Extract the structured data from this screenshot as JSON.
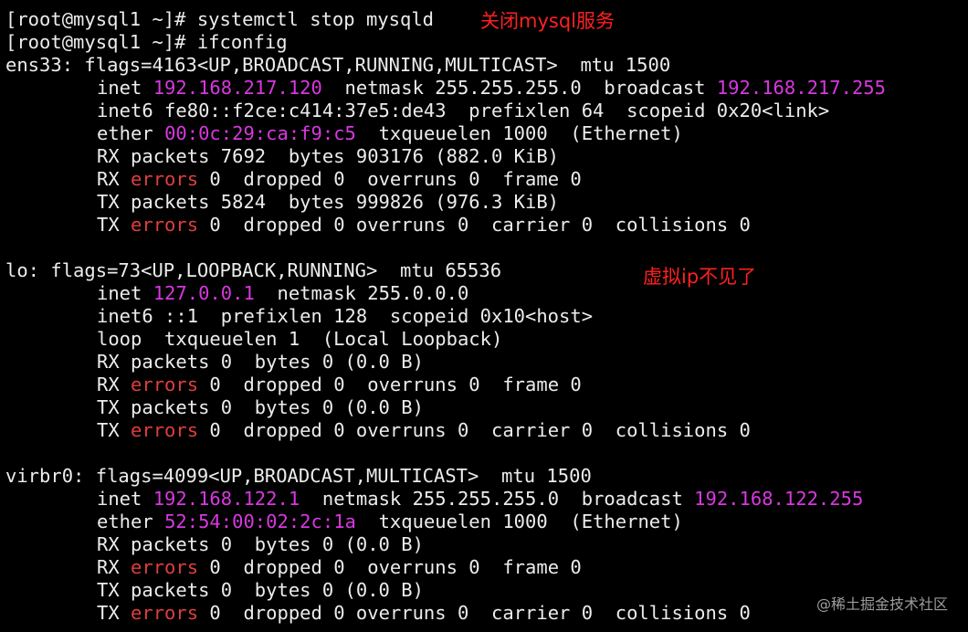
{
  "terminal": {
    "lines": [
      {
        "parts": [
          {
            "t": "[root@mysql1 ~]# systemctl stop mysqld"
          }
        ]
      },
      {
        "parts": [
          {
            "t": "[root@mysql1 ~]# ifconfig"
          }
        ]
      },
      {
        "parts": [
          {
            "t": "ens33: flags=4163<UP,BROADCAST,RUNNING,MULTICAST>  mtu 1500"
          }
        ]
      },
      {
        "indent": true,
        "parts": [
          {
            "t": "inet "
          },
          {
            "t": "192.168.217.120",
            "c": "mag"
          },
          {
            "t": "  netmask 255.255.255.0  broadcast "
          },
          {
            "t": "192.168.217.255",
            "c": "mag"
          }
        ]
      },
      {
        "indent": true,
        "parts": [
          {
            "t": "inet6 fe80::f2ce:c414:37e5:de43  prefixlen 64  scopeid 0x20<link>"
          }
        ]
      },
      {
        "indent": true,
        "parts": [
          {
            "t": "ether "
          },
          {
            "t": "00:0c:29:ca:f9:c5",
            "c": "mag"
          },
          {
            "t": "  txqueuelen 1000  (Ethernet)"
          }
        ]
      },
      {
        "indent": true,
        "parts": [
          {
            "t": "RX packets 7692  bytes 903176 (882.0 KiB)"
          }
        ]
      },
      {
        "indent": true,
        "parts": [
          {
            "t": "RX "
          },
          {
            "t": "errors",
            "c": "red"
          },
          {
            "t": " 0  dropped 0  overruns 0  frame 0"
          }
        ]
      },
      {
        "indent": true,
        "parts": [
          {
            "t": "TX packets 5824  bytes 999826 (976.3 KiB)"
          }
        ]
      },
      {
        "indent": true,
        "parts": [
          {
            "t": "TX "
          },
          {
            "t": "errors",
            "c": "red"
          },
          {
            "t": " 0  dropped 0 overruns 0  carrier 0  collisions 0"
          }
        ]
      },
      {
        "parts": [
          {
            "t": ""
          }
        ]
      },
      {
        "parts": [
          {
            "t": "lo: flags=73<UP,LOOPBACK,RUNNING>  mtu 65536"
          }
        ]
      },
      {
        "indent": true,
        "parts": [
          {
            "t": "inet "
          },
          {
            "t": "127.0.0.1",
            "c": "mag"
          },
          {
            "t": "  netmask 255.0.0.0"
          }
        ]
      },
      {
        "indent": true,
        "parts": [
          {
            "t": "inet6 ::1  prefixlen 128  scopeid 0x10<host>"
          }
        ]
      },
      {
        "indent": true,
        "parts": [
          {
            "t": "loop  txqueuelen 1  (Local Loopback)"
          }
        ]
      },
      {
        "indent": true,
        "parts": [
          {
            "t": "RX packets 0  bytes 0 (0.0 B)"
          }
        ]
      },
      {
        "indent": true,
        "parts": [
          {
            "t": "RX "
          },
          {
            "t": "errors",
            "c": "red"
          },
          {
            "t": " 0  dropped 0  overruns 0  frame 0"
          }
        ]
      },
      {
        "indent": true,
        "parts": [
          {
            "t": "TX packets 0  bytes 0 (0.0 B)"
          }
        ]
      },
      {
        "indent": true,
        "parts": [
          {
            "t": "TX "
          },
          {
            "t": "errors",
            "c": "red"
          },
          {
            "t": " 0  dropped 0 overruns 0  carrier 0  collisions 0"
          }
        ]
      },
      {
        "parts": [
          {
            "t": ""
          }
        ]
      },
      {
        "parts": [
          {
            "t": "virbr0: flags=4099<UP,BROADCAST,MULTICAST>  mtu 1500"
          }
        ]
      },
      {
        "indent": true,
        "parts": [
          {
            "t": "inet "
          },
          {
            "t": "192.168.122.1",
            "c": "mag"
          },
          {
            "t": "  netmask 255.255.255.0  broadcast "
          },
          {
            "t": "192.168.122.255",
            "c": "mag"
          }
        ]
      },
      {
        "indent": true,
        "parts": [
          {
            "t": "ether "
          },
          {
            "t": "52:54:00:02:2c:1a",
            "c": "mag"
          },
          {
            "t": "  txqueuelen 1000  (Ethernet)"
          }
        ]
      },
      {
        "indent": true,
        "parts": [
          {
            "t": "RX packets 0  bytes 0 (0.0 B)"
          }
        ]
      },
      {
        "indent": true,
        "parts": [
          {
            "t": "RX "
          },
          {
            "t": "errors",
            "c": "red"
          },
          {
            "t": " 0  dropped 0  overruns 0  frame 0"
          }
        ]
      },
      {
        "indent": true,
        "parts": [
          {
            "t": "TX packets 0  bytes 0 (0.0 B)"
          }
        ]
      },
      {
        "indent": true,
        "parts": [
          {
            "t": "TX "
          },
          {
            "t": "errors",
            "c": "red"
          },
          {
            "t": " 0  dropped 0 overruns 0  carrier 0  collisions 0"
          }
        ]
      }
    ]
  },
  "annotations": {
    "stop_note": "关闭mysql服务",
    "vip_note": "虚拟ip不见了"
  },
  "watermark": "@稀土掘金技术社区",
  "colors": {
    "background": "#000000",
    "text": "#ececec",
    "ip_highlight": "#d838e0",
    "error_keyword": "#e03e3e",
    "annotation": "#ff2020"
  }
}
